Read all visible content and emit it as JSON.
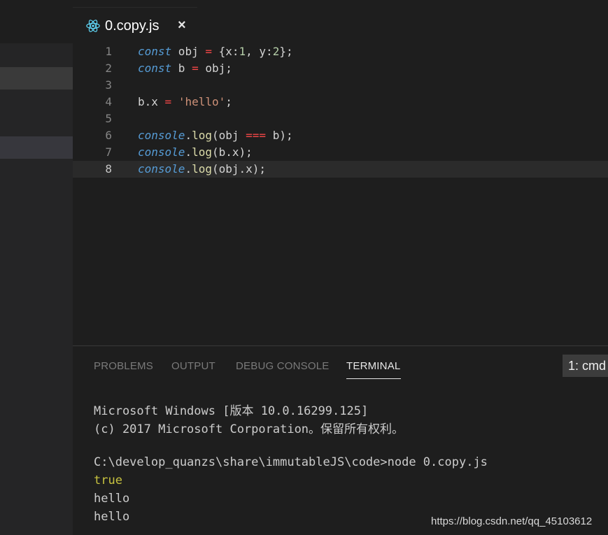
{
  "tab": {
    "label": "0.copy.js",
    "close": "×"
  },
  "editor": {
    "lines": [
      {
        "n": "1",
        "tokens": [
          [
            "kw",
            "const"
          ],
          [
            "pun",
            " obj "
          ],
          [
            "op",
            "="
          ],
          [
            "pun",
            " {x:"
          ],
          [
            "num",
            "1"
          ],
          [
            "pun",
            ", y:"
          ],
          [
            "num",
            "2"
          ],
          [
            "pun",
            "};"
          ]
        ]
      },
      {
        "n": "2",
        "tokens": [
          [
            "kw",
            "const"
          ],
          [
            "pun",
            " b "
          ],
          [
            "op",
            "="
          ],
          [
            "pun",
            " obj;"
          ]
        ]
      },
      {
        "n": "3",
        "tokens": []
      },
      {
        "n": "4",
        "tokens": [
          [
            "pun",
            "b.x "
          ],
          [
            "op",
            "="
          ],
          [
            "pun",
            " "
          ],
          [
            "str",
            "'hello'"
          ],
          [
            "pun",
            ";"
          ]
        ]
      },
      {
        "n": "5",
        "tokens": []
      },
      {
        "n": "6",
        "tokens": [
          [
            "obj",
            "console"
          ],
          [
            "pun",
            "."
          ],
          [
            "fn",
            "log"
          ],
          [
            "pun",
            "(obj "
          ],
          [
            "op",
            "==="
          ],
          [
            "pun",
            " b);"
          ]
        ]
      },
      {
        "n": "7",
        "tokens": [
          [
            "obj",
            "console"
          ],
          [
            "pun",
            "."
          ],
          [
            "fn",
            "log"
          ],
          [
            "pun",
            "(b.x);"
          ]
        ]
      },
      {
        "n": "8",
        "tokens": [
          [
            "obj",
            "console"
          ],
          [
            "pun",
            "."
          ],
          [
            "fn",
            "log"
          ],
          [
            "pun",
            "(obj.x);"
          ]
        ]
      }
    ]
  },
  "panel": {
    "tabs": [
      "PROBLEMS",
      "OUTPUT",
      "DEBUG CONSOLE",
      "TERMINAL"
    ],
    "active_tab": "TERMINAL",
    "terminal_select": "1: cmd",
    "terminal_lines": [
      "Microsoft Windows [版本 10.0.16299.125]",
      "(c) 2017 Microsoft Corporation。保留所有权利。",
      "",
      "C:\\develop_quanzs\\share\\immutableJS\\code>node 0.copy.js",
      "true",
      "hello",
      "hello"
    ]
  },
  "watermark": "https://blog.csdn.net/qq_45103612",
  "colors": {
    "accent_keyword": "#569cd6",
    "operator": "#f44747",
    "string": "#ce9178",
    "number": "#b5cea8",
    "terminal_true": "#c7c23f"
  }
}
